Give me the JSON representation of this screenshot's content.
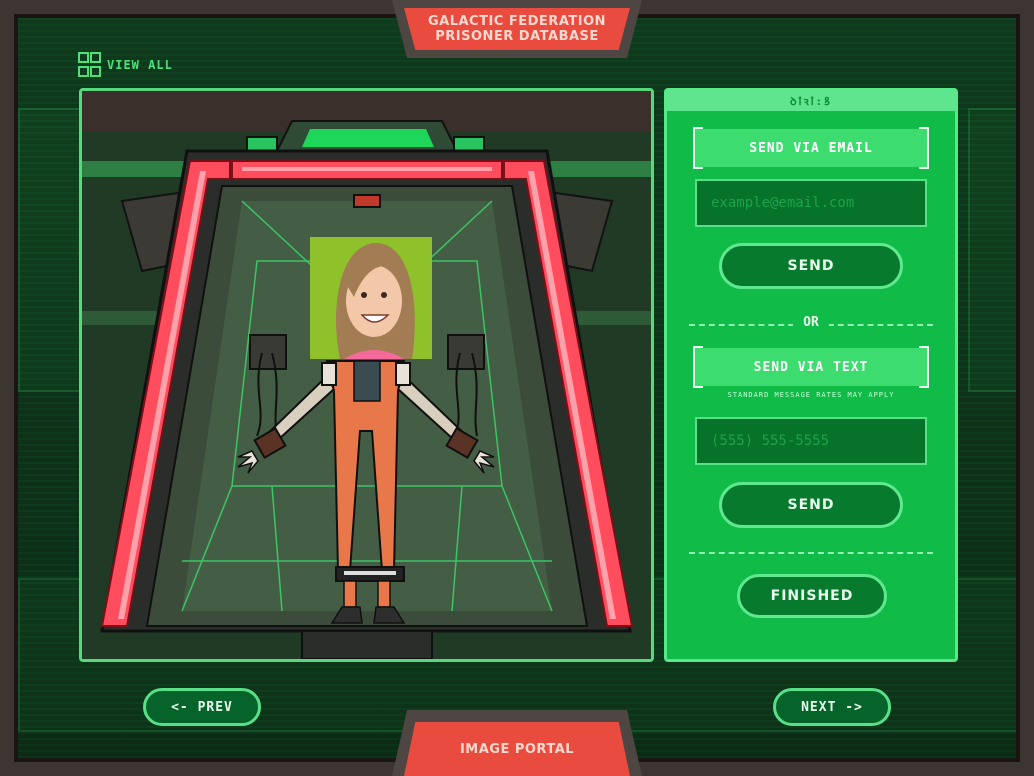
{
  "header": {
    "title_line1": "GALACTIC FEDERATION",
    "title_line2": "PRISONER DATABASE"
  },
  "footer": {
    "title": "IMAGE PORTAL"
  },
  "view_all": {
    "label": "VIEW ALL",
    "icon": "grid-icon"
  },
  "panel": {
    "header_glyphs": "ꝺꝉꝛꝉ꞉ꝸ",
    "email": {
      "label": "SEND VIA EMAIL",
      "placeholder": "example@email.com",
      "button": "SEND"
    },
    "divider": "OR",
    "text": {
      "label": "SEND VIA TEXT",
      "note": "STANDARD MESSAGE RATES MAY APPLY",
      "placeholder": "(555) 555-5555",
      "button": "SEND"
    },
    "finished": "FINISHED"
  },
  "nav": {
    "prev": "<- PREV",
    "next": "NEXT ->"
  },
  "colors": {
    "accent": "#10bb47",
    "banner": "#e94b3f",
    "glow": "#58e088"
  }
}
